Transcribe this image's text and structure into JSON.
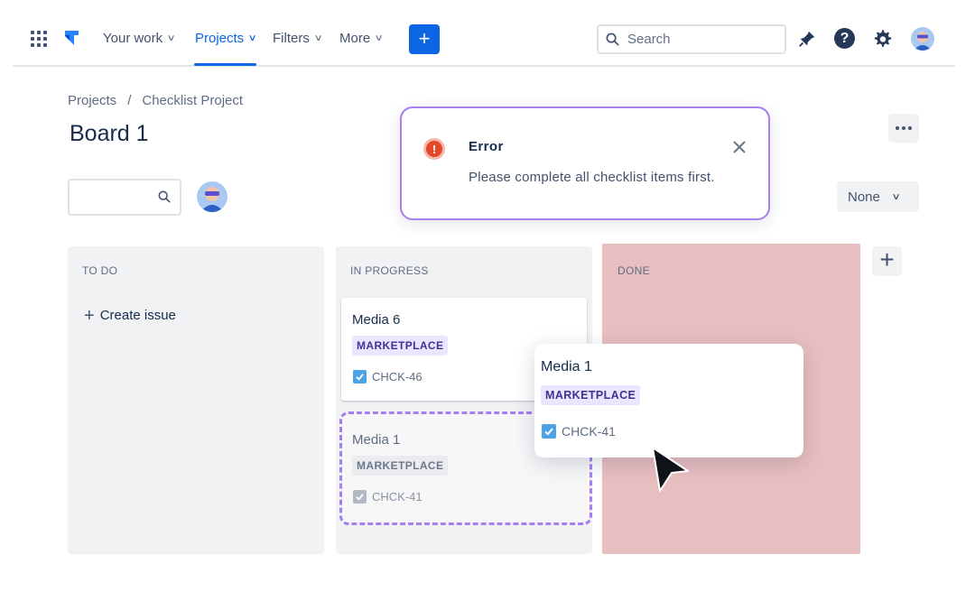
{
  "nav": {
    "items": [
      {
        "label": "Your work"
      },
      {
        "label": "Projects"
      },
      {
        "label": "Filters"
      },
      {
        "label": "More"
      }
    ],
    "create_label": "+",
    "search_placeholder": "Search",
    "help_label": "?"
  },
  "header": {
    "breadcrumb": [
      "Projects",
      "/",
      "Checklist Project"
    ],
    "title": "Board 1",
    "group_by": "None"
  },
  "columns": [
    {
      "name": "TO DO",
      "create_label": "Create issue"
    },
    {
      "name": "IN PROGRESS"
    },
    {
      "name": "DONE"
    }
  ],
  "cards": {
    "media6": {
      "title": "Media 6",
      "tag": "MARKETPLACE",
      "key": "CHCK-46"
    },
    "media1_ghost": {
      "title": "Media 1",
      "tag": "MARKETPLACE",
      "key": "CHCK-41"
    },
    "media1_drag": {
      "title": "Media 1",
      "tag": "MARKETPLACE",
      "key": "CHCK-41"
    }
  },
  "toast": {
    "title": "Error",
    "message": "Please complete all checklist items first."
  },
  "colors": {
    "accent": "#0c66e4",
    "done_column_error": "#e8bfc0",
    "toast_border": "#a97ff0",
    "error_icon": "#e2492b",
    "tag_purple_bg": "#eae6ff",
    "tag_purple_text": "#403294"
  },
  "icons": [
    "app-switcher-icon",
    "jira-logo-icon",
    "search-icon",
    "notification-icon",
    "help-icon",
    "settings-icon",
    "avatar",
    "more-icon",
    "close-icon",
    "error-icon",
    "checkbox-icon",
    "plus-icon",
    "cursor-icon"
  ]
}
